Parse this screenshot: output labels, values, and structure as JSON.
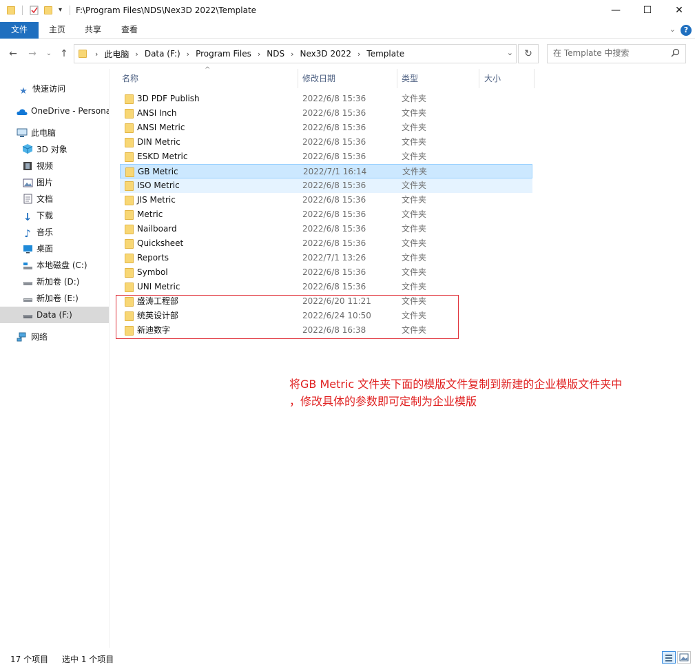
{
  "window": {
    "title": "F:\\Program Files\\NDS\\Nex3D 2022\\Template",
    "minimize": "—",
    "maximize": "☐",
    "close": "✕"
  },
  "ribbon": {
    "tabs": [
      "文件",
      "主页",
      "共享",
      "查看"
    ],
    "help": "?",
    "collapse": "⌄"
  },
  "nav": {
    "back": "←",
    "forward": "→",
    "recent": "⌄",
    "up": "↑",
    "breadcrumbs": [
      "此电脑",
      "Data (F:)",
      "Program Files",
      "NDS",
      "Nex3D 2022",
      "Template"
    ],
    "crumb_sep": "›",
    "dropdown": "⌄",
    "refresh": "↻"
  },
  "search": {
    "placeholder": "在 Template 中搜索",
    "icon": "search-icon"
  },
  "sidebar": {
    "items": [
      {
        "label": "快速访问",
        "icon": "star-icon"
      },
      {
        "label": "OneDrive - Persona",
        "icon": "cloud-icon"
      },
      {
        "label": "此电脑",
        "icon": "computer-icon"
      },
      {
        "label": "3D 对象",
        "icon": "3d-objects-icon"
      },
      {
        "label": "视频",
        "icon": "video-icon"
      },
      {
        "label": "图片",
        "icon": "pictures-icon"
      },
      {
        "label": "文档",
        "icon": "documents-icon"
      },
      {
        "label": "下载",
        "icon": "download-icon"
      },
      {
        "label": "音乐",
        "icon": "music-icon"
      },
      {
        "label": "桌面",
        "icon": "desktop-icon"
      },
      {
        "label": "本地磁盘 (C:)",
        "icon": "drive-c-icon"
      },
      {
        "label": "新加卷 (D:)",
        "icon": "drive-icon"
      },
      {
        "label": "新加卷 (E:)",
        "icon": "drive-icon"
      },
      {
        "label": "Data (F:)",
        "icon": "drive-icon"
      },
      {
        "label": "网络",
        "icon": "network-icon"
      }
    ]
  },
  "columns": {
    "name": "名称",
    "modified": "修改日期",
    "type": "类型",
    "size": "大小",
    "sort_indicator": "^"
  },
  "files": [
    {
      "name": "3D PDF Publish",
      "date": "2022/6/8 15:36",
      "type": "文件夹"
    },
    {
      "name": "ANSI Inch",
      "date": "2022/6/8 15:36",
      "type": "文件夹"
    },
    {
      "name": "ANSI Metric",
      "date": "2022/6/8 15:36",
      "type": "文件夹"
    },
    {
      "name": "DIN Metric",
      "date": "2022/6/8 15:36",
      "type": "文件夹"
    },
    {
      "name": "ESKD Metric",
      "date": "2022/6/8 15:36",
      "type": "文件夹"
    },
    {
      "name": "GB Metric",
      "date": "2022/7/1 16:14",
      "type": "文件夹",
      "state": "selected"
    },
    {
      "name": "ISO Metric",
      "date": "2022/6/8 15:36",
      "type": "文件夹",
      "state": "hover"
    },
    {
      "name": "JIS Metric",
      "date": "2022/6/8 15:36",
      "type": "文件夹"
    },
    {
      "name": "Metric",
      "date": "2022/6/8 15:36",
      "type": "文件夹"
    },
    {
      "name": "Nailboard",
      "date": "2022/6/8 15:36",
      "type": "文件夹"
    },
    {
      "name": "Quicksheet",
      "date": "2022/6/8 15:36",
      "type": "文件夹"
    },
    {
      "name": "Reports",
      "date": "2022/7/1 13:26",
      "type": "文件夹"
    },
    {
      "name": "Symbol",
      "date": "2022/6/8 15:36",
      "type": "文件夹"
    },
    {
      "name": "UNI Metric",
      "date": "2022/6/8 15:36",
      "type": "文件夹"
    },
    {
      "name": "盛涛工程部",
      "date": "2022/6/20 11:21",
      "type": "文件夹"
    },
    {
      "name": "统英设计部",
      "date": "2022/6/24 10:50",
      "type": "文件夹"
    },
    {
      "name": "新迪数字",
      "date": "2022/6/8 16:38",
      "type": "文件夹"
    }
  ],
  "annotation": {
    "line1": "将GB Metric 文件夹下面的模版文件复制到新建的企业模版文件夹中",
    "line2": "，修改具体的参数即可定制为企业模版",
    "color": "#e02020"
  },
  "status": {
    "count": "17 个项目",
    "selected": "选中 1 个项目"
  }
}
